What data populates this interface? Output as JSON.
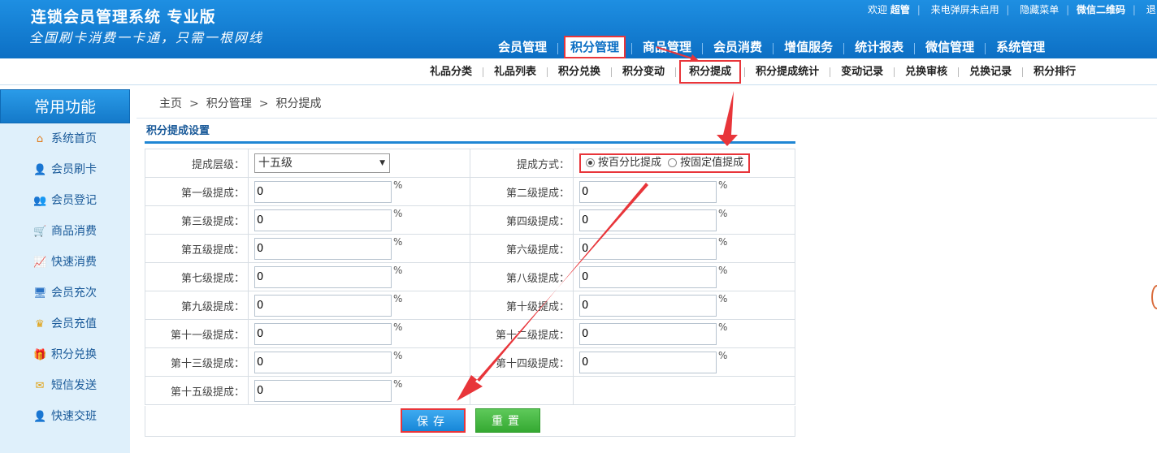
{
  "header": {
    "title": "连锁会员管理系统 专业版",
    "slogan": "全国刷卡消费一卡通，只需一根网线",
    "welcome": "欢迎",
    "username": "超管",
    "link_popup": "来电弹屏未启用",
    "link_hide_menu": "隐藏菜单",
    "link_wechat_qr": "微信二维码",
    "link_logout": "退出系统"
  },
  "main_nav": {
    "items": [
      "会员管理",
      "积分管理",
      "商品管理",
      "会员消费",
      "增值服务",
      "统计报表",
      "微信管理",
      "系统管理"
    ],
    "active_index": 1
  },
  "sub_nav": {
    "items": [
      "礼品分类",
      "礼品列表",
      "积分兑换",
      "积分变动",
      "积分提成",
      "积分提成统计",
      "变动记录",
      "兑换审核",
      "兑换记录",
      "积分排行"
    ],
    "active_index": 4
  },
  "sidebar": {
    "title": "常用功能",
    "items": [
      {
        "label": "系统首页",
        "icon": "home-icon",
        "glyph": "⌂",
        "color": "#e07b1a"
      },
      {
        "label": "会员刷卡",
        "icon": "user-card-icon",
        "glyph": "👤",
        "color": "#2a72c4"
      },
      {
        "label": "会员登记",
        "icon": "user-register-icon",
        "glyph": "👥",
        "color": "#2a72c4"
      },
      {
        "label": "商品消费",
        "icon": "cart-icon",
        "glyph": "🛒",
        "color": "#d78a14"
      },
      {
        "label": "快速消费",
        "icon": "chart-icon",
        "glyph": "📈",
        "color": "#c9362b"
      },
      {
        "label": "会员充次",
        "icon": "recharge-times-icon",
        "glyph": "🖥",
        "color": "#2a72c4"
      },
      {
        "label": "会员充值",
        "icon": "crown-icon",
        "glyph": "♛",
        "color": "#e0a010"
      },
      {
        "label": "积分兑换",
        "icon": "gift-icon",
        "glyph": "🎁",
        "color": "#2a8ad4"
      },
      {
        "label": "短信发送",
        "icon": "mail-icon",
        "glyph": "✉",
        "color": "#e0a010"
      },
      {
        "label": "快速交班",
        "icon": "handover-icon",
        "glyph": "👤",
        "color": "#2a72c4"
      }
    ]
  },
  "breadcrumb": {
    "items": [
      "主页",
      "积分管理",
      "积分提成"
    ],
    "separator": ">"
  },
  "panel": {
    "title": "积分提成设置",
    "level_label": "提成层级：",
    "level_value": "十五级",
    "method_label": "提成方式：",
    "method_options": [
      "按百分比提成",
      "按固定值提成"
    ],
    "method_selected": 0,
    "percent_unit": "%",
    "levels": [
      {
        "label": "第一级提成：",
        "value": "0"
      },
      {
        "label": "第二级提成：",
        "value": "0"
      },
      {
        "label": "第三级提成：",
        "value": "0"
      },
      {
        "label": "第四级提成：",
        "value": "0"
      },
      {
        "label": "第五级提成：",
        "value": "0"
      },
      {
        "label": "第六级提成：",
        "value": "0"
      },
      {
        "label": "第七级提成：",
        "value": "0"
      },
      {
        "label": "第八级提成：",
        "value": "0"
      },
      {
        "label": "第九级提成：",
        "value": "0"
      },
      {
        "label": "第十级提成：",
        "value": "0"
      },
      {
        "label": "第十一级提成：",
        "value": "0"
      },
      {
        "label": "第十二级提成：",
        "value": "0"
      },
      {
        "label": "第十三级提成：",
        "value": "0"
      },
      {
        "label": "第十四级提成：",
        "value": "0"
      },
      {
        "label": "第十五级提成：",
        "value": "0"
      }
    ],
    "save_label": "保存",
    "reset_label": "重置"
  },
  "colors": {
    "header_blue": "#0c6fc4",
    "highlight_red": "#e8353a",
    "save_blue": "#1787d8",
    "reset_green": "#35a932"
  }
}
